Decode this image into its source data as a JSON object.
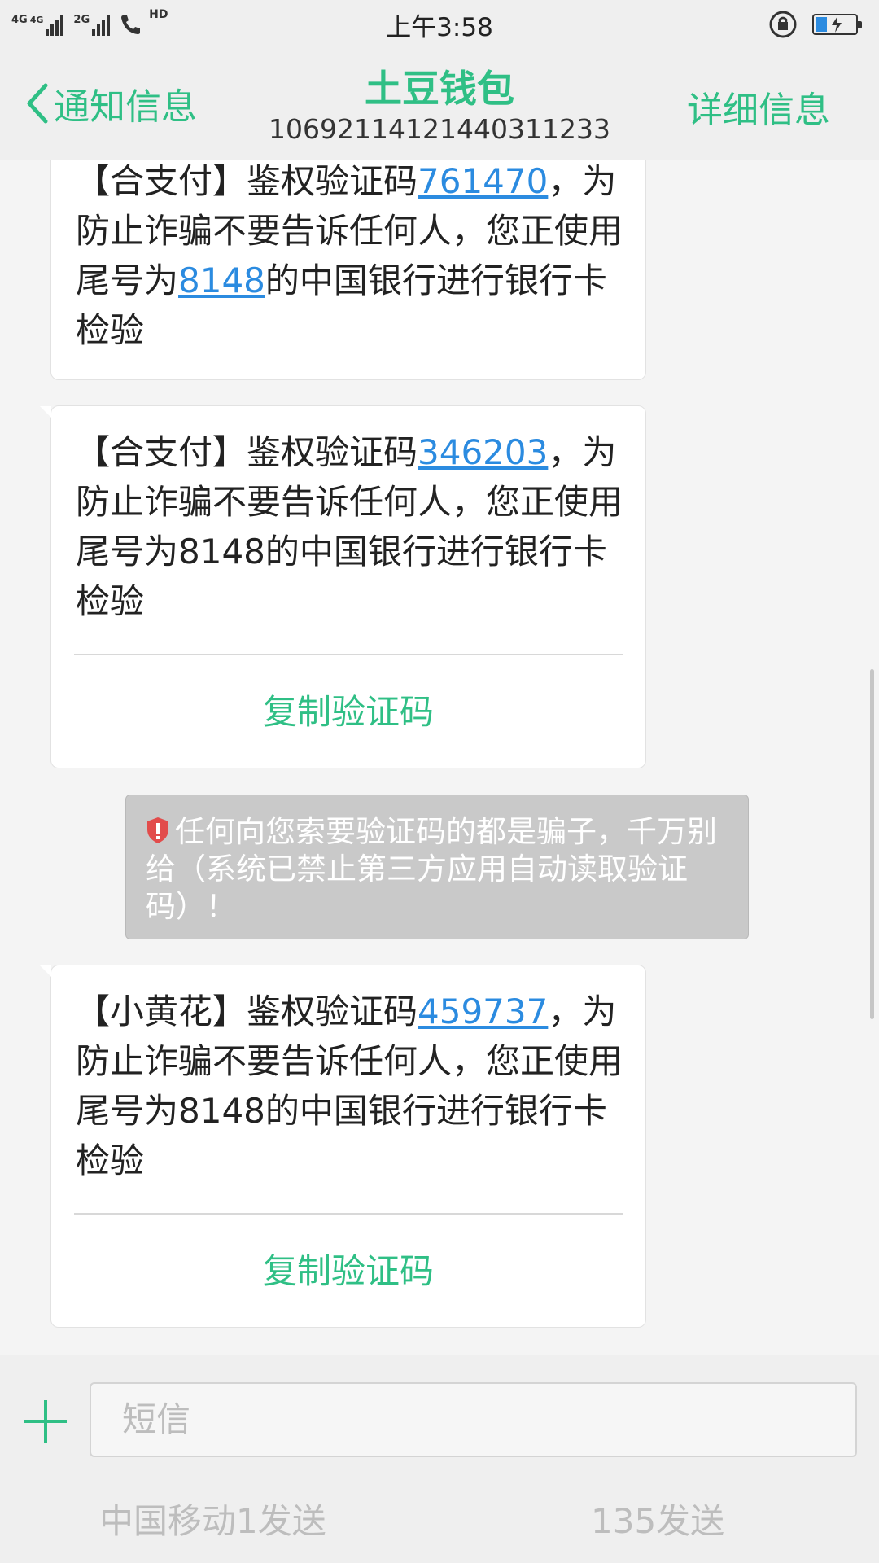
{
  "status_bar": {
    "sim1_label": "4G",
    "sim1_sub_label": "4G",
    "sim2_label": "2G",
    "hd_label": "HD",
    "time": "上午3:58",
    "icons": [
      "signal-icon",
      "call-hd-icon",
      "rotation-lock-icon",
      "battery-charging-icon"
    ]
  },
  "header": {
    "back_label": "通知信息",
    "title": "土豆钱包",
    "number": "1069211412144031123​3",
    "details_label": "详细信息"
  },
  "messages": [
    {
      "before": "【合支付】鉴权验证码",
      "code": "761470",
      "middle": "，为防止诈骗不要告诉任何人，您正使用尾号为",
      "card": "8148",
      "after": "的中国银行进行银行卡检验"
    },
    {
      "before": "【合支付】鉴权验证码",
      "code": "346203",
      "after": "，为防止诈骗不要告诉任何人，您正使用尾号为8148的中国银行进行银行卡检验",
      "copy_label": "复制验证码"
    },
    {
      "before": "【小黄花】鉴权验证码",
      "code": "459737",
      "after": "，为防止诈骗不要告诉任何人，您正使用尾号为8148的中国银行进行银行卡检验",
      "copy_label": "复制验证码"
    }
  ],
  "warning": {
    "text": "任何向您索要验证码的都是骗子，千万别给（系统已禁止第三方应用自动读取验证码）！",
    "icon": "shield-alert-icon",
    "color": "#e24c4b"
  },
  "composer": {
    "placeholder": "短信",
    "send_sim1_label": "中国移动1发送",
    "send_sim2_label": "135发送"
  },
  "colors": {
    "accent": "#2fbf85",
    "link": "#2b8be0"
  }
}
